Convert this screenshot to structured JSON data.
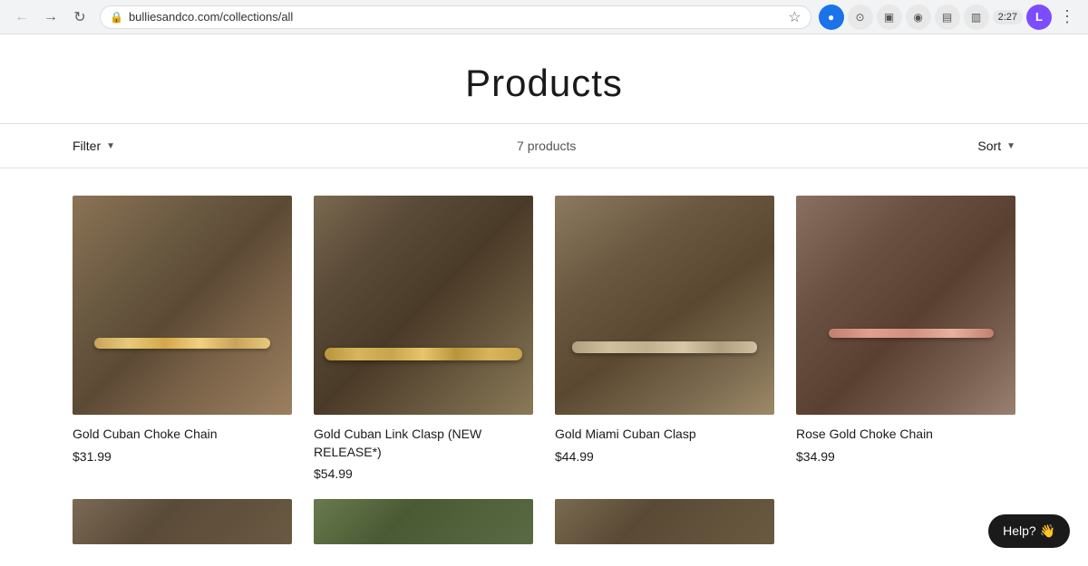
{
  "browser": {
    "url": "bulliesandco.com/collections/all",
    "time": "2:27",
    "avatar_letter": "L"
  },
  "page": {
    "title": "Products",
    "product_count": "7 products",
    "filter_label": "Filter",
    "sort_label": "Sort"
  },
  "products": [
    {
      "id": 1,
      "name": "Gold Cuban Choke Chain",
      "price": "$31.99",
      "img_class": "img-gold-choke"
    },
    {
      "id": 2,
      "name": "Gold Cuban Link Clasp (NEW RELEASE*)",
      "price": "$54.99",
      "img_class": "img-cuban-link"
    },
    {
      "id": 3,
      "name": "Gold Miami Cuban Clasp",
      "price": "$44.99",
      "img_class": "img-miami-cuban"
    },
    {
      "id": 4,
      "name": "Rose Gold Choke Chain",
      "price": "$34.99",
      "img_class": "img-rose-gold"
    }
  ],
  "bottom_products": [
    {
      "id": 5,
      "img_class": "img-bottom1"
    },
    {
      "id": 6,
      "img_class": "img-bottom2"
    },
    {
      "id": 7,
      "img_class": "img-bottom3"
    }
  ],
  "help_button": {
    "label": "Help? 👋"
  }
}
